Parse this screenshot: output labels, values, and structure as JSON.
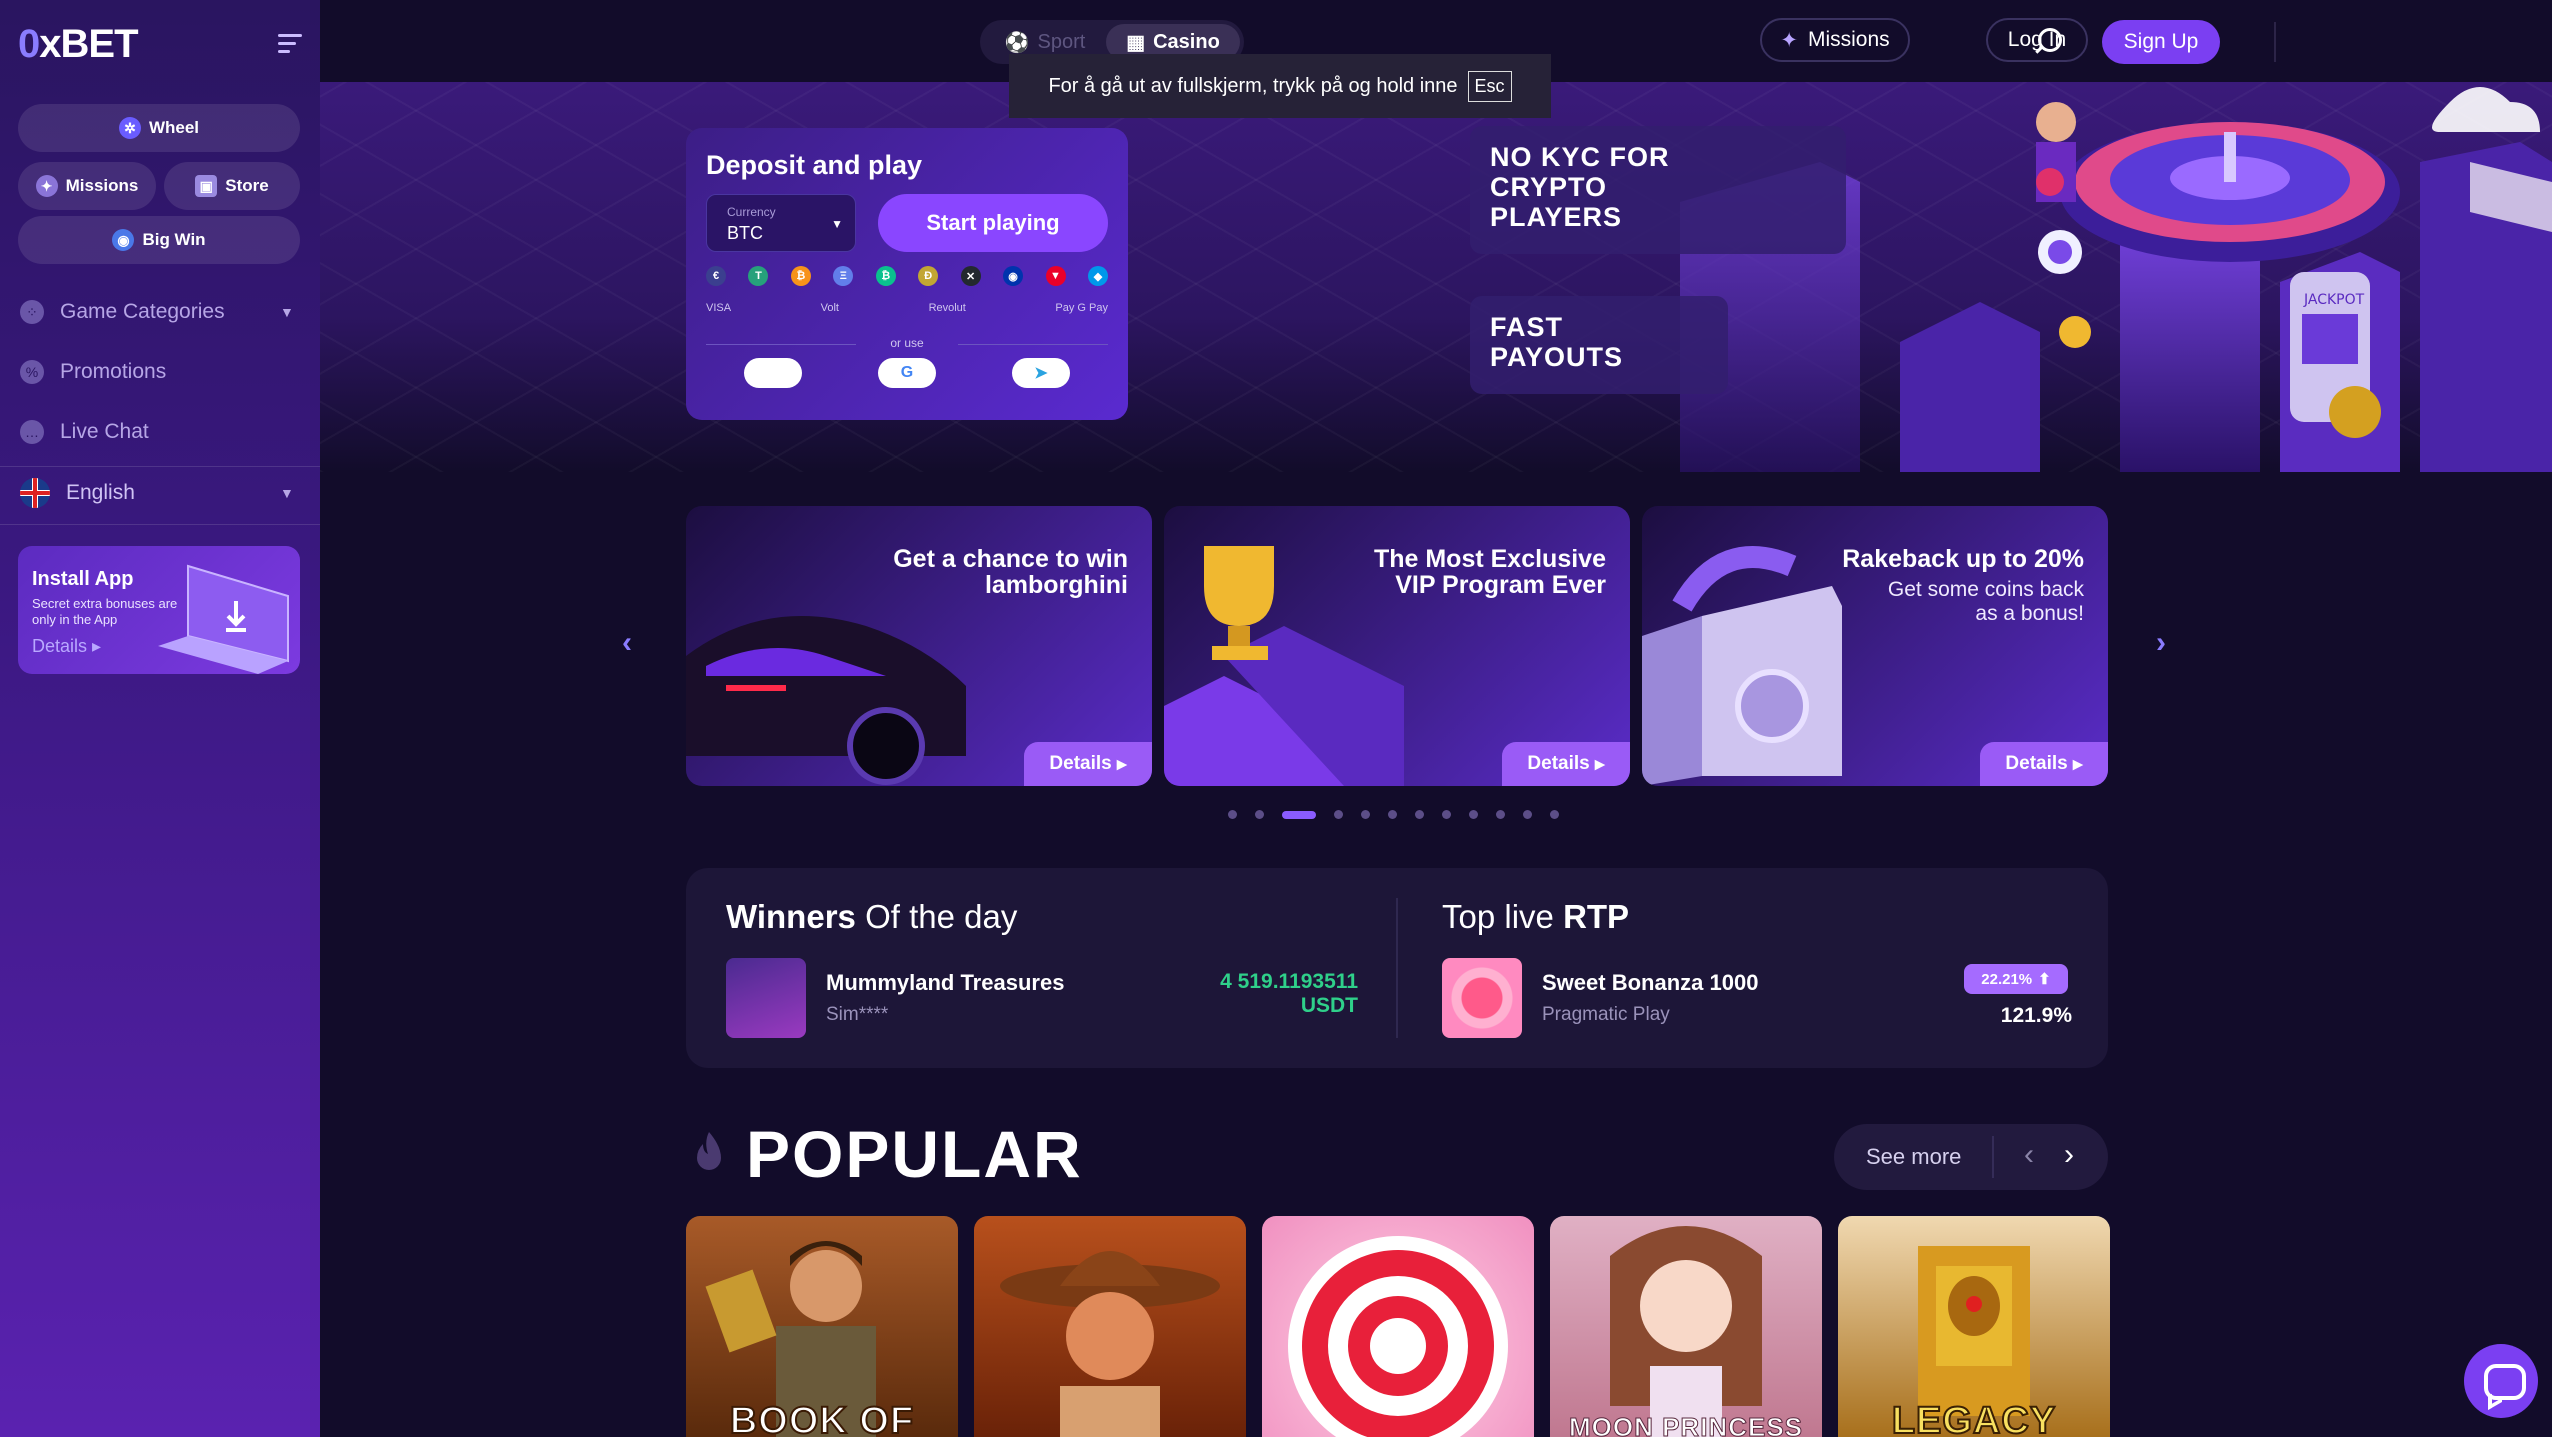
{
  "brand": {
    "logo_prefix": "0",
    "logo_text": "xBET",
    "accent": "#7b3ff2"
  },
  "sidebar": {
    "pills": [
      {
        "label": "Wheel",
        "icon": "wheel-icon"
      },
      {
        "label": "Missions",
        "icon": "missions-icon"
      },
      {
        "label": "Store",
        "icon": "store-icon"
      },
      {
        "label": "Big Win",
        "icon": "big-win-icon"
      }
    ],
    "nav": [
      {
        "label": "Game Categories",
        "icon": "categories-icon"
      },
      {
        "label": "Promotions",
        "icon": "promotions-icon"
      },
      {
        "label": "Live Chat",
        "icon": "chat-icon"
      }
    ],
    "language": "English",
    "install": {
      "title": "Install App",
      "subtitle": "Secret extra bonuses are only in the App",
      "details": "Details"
    }
  },
  "topbar": {
    "mode_sport": "Sport",
    "mode_casino": "Casino",
    "missions": "Missions",
    "login": "Log In",
    "signup": "Sign Up"
  },
  "toast": {
    "text": "For å gå ut av fullskjerm, trykk på og hold inne",
    "key": "Esc"
  },
  "deposit": {
    "title": "Deposit and play",
    "currency_label": "Currency",
    "currency_value": "BTC",
    "start": "Start playing",
    "coins": [
      {
        "symbol": "€",
        "color": "#3b3f8f"
      },
      {
        "symbol": "T",
        "color": "#26a17b"
      },
      {
        "symbol": "₿",
        "color": "#f7931a"
      },
      {
        "symbol": "Ξ",
        "color": "#627eea"
      },
      {
        "symbol": "₿",
        "color": "#0ac18e"
      },
      {
        "symbol": "Ð",
        "color": "#c2a633"
      },
      {
        "symbol": "✕",
        "color": "#23292f"
      },
      {
        "symbol": "◉",
        "color": "#0033ad"
      },
      {
        "symbol": "▼",
        "color": "#eb0029"
      },
      {
        "symbol": "◆",
        "color": "#0098ea"
      }
    ],
    "pay_labels": [
      "VISA",
      "Volt",
      "Revolut",
      "Pay G Pay"
    ],
    "or_use": "or use"
  },
  "hero_features": {
    "kyc": "NO KYC FOR CRYPTO PLAYERS",
    "payouts": "FAST PAYOUTS"
  },
  "promos": [
    {
      "title": "Get a chance to win lamborghini",
      "subtitle": "",
      "details": "Details"
    },
    {
      "title": "The Most Exclusive VIP Program Ever",
      "subtitle": "",
      "details": "Details"
    },
    {
      "title": "Rakeback up to 20%",
      "subtitle": "Get some coins back as a bonus!",
      "details": "Details"
    }
  ],
  "carousel": {
    "dot_count": 12,
    "active_dot": 3
  },
  "winners": {
    "title_bold": "Winners",
    "title_rest": "Of the day",
    "game": "Mummyland Treasures",
    "user": "Sim****",
    "amount": "4 519.1193511 USDT"
  },
  "rtp": {
    "title_rest": "Top live",
    "title_bold": "RTP",
    "game": "Sweet Bonanza 1000",
    "provider": "Pragmatic Play",
    "badge": "22.21%",
    "value": "121.9%"
  },
  "popular": {
    "title": "POPULAR",
    "see_more": "See more",
    "games": [
      {
        "caption": "BOOK OF",
        "bg": "#7a3a14"
      },
      {
        "caption": "",
        "bg": "#8a3416"
      },
      {
        "caption": "",
        "bg": "#f5a0c8"
      },
      {
        "caption": "MOON PRINCESS",
        "bg": "#d89ab0"
      },
      {
        "caption": "LEGACY",
        "bg": "#c48a2a"
      }
    ]
  }
}
